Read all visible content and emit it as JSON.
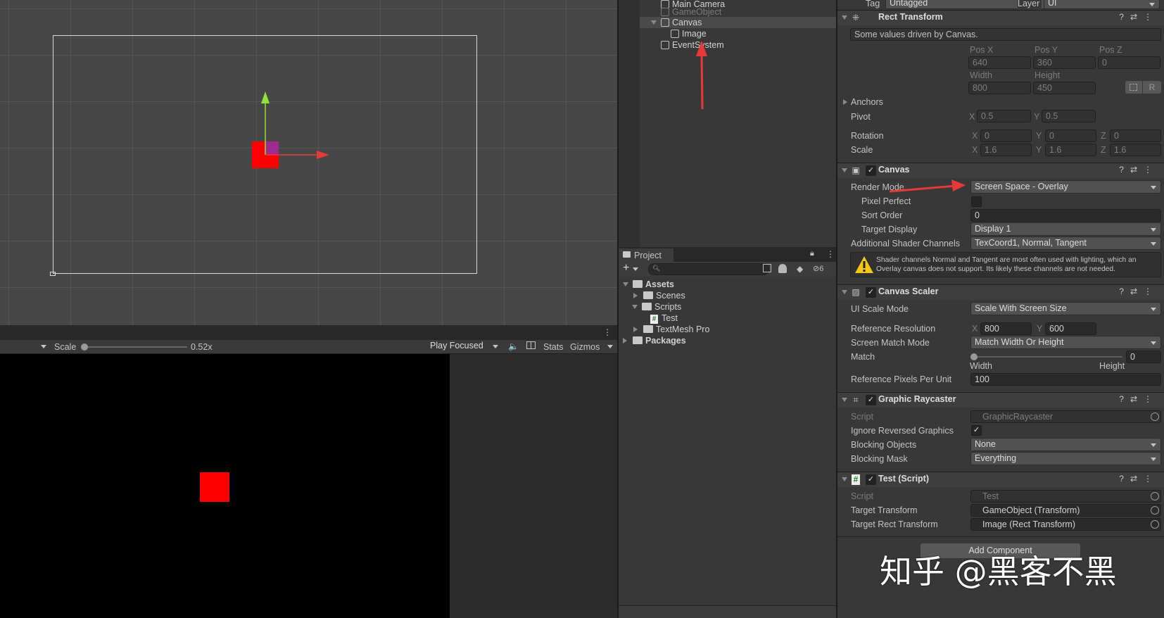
{
  "scene_view": {
    "name": "scene-view"
  },
  "game_toolbar": {
    "scale_label": "Scale",
    "scale_value": "0.52x",
    "scale_fraction": 0.0,
    "play_mode": "Play Focused",
    "stats": "Stats",
    "gizmos": "Gizmos"
  },
  "hierarchy": {
    "items": [
      "Main Camera",
      "GameObject",
      "Canvas",
      "Image",
      "EventSystem"
    ]
  },
  "project": {
    "tab": "Project",
    "badge": "6",
    "tree": [
      "Assets",
      "Scenes",
      "Scripts",
      "Test",
      "TextMesh Pro",
      "Packages"
    ]
  },
  "inspector": {
    "tag_label": "Tag",
    "tag_value": "Untagged",
    "layer_label": "Layer",
    "layer_value": "UI",
    "rect": {
      "title": "Rect Transform",
      "note": "Some values driven by Canvas.",
      "posx_label": "Pos X",
      "posy_label": "Pos Y",
      "posz_label": "Pos Z",
      "posx": "640",
      "posy": "360",
      "posz": "0",
      "width_label": "Width",
      "height_label": "Height",
      "width": "800",
      "height": "450",
      "r_button": "R",
      "anchors": "Anchors",
      "pivot": "Pivot",
      "pivot_x": "0.5",
      "pivot_y": "0.5",
      "rotation": "Rotation",
      "rot_x": "0",
      "rot_y": "0",
      "rot_z": "0",
      "scale": "Scale",
      "scale_x": "1.6",
      "scale_y": "1.6",
      "scale_z": "1.6",
      "x": "X",
      "y": "Y",
      "z": "Z"
    },
    "canvas": {
      "title": "Canvas",
      "render_mode_label": "Render Mode",
      "render_mode": "Screen Space - Overlay",
      "pixel_perfect": "Pixel Perfect",
      "sort_order_label": "Sort Order",
      "sort_order": "0",
      "target_display_label": "Target Display",
      "target_display": "Display 1",
      "shader_label": "Additional Shader Channels",
      "shader_value": "TexCoord1, Normal, Tangent",
      "warning": "Shader channels Normal and Tangent are most often used with lighting, which an Overlay canvas does not support. Its likely these channels are not needed."
    },
    "scaler": {
      "title": "Canvas Scaler",
      "ui_scale_label": "UI Scale Mode",
      "ui_scale": "Scale With Screen Size",
      "ref_res_label": "Reference Resolution",
      "ref_x": "800",
      "ref_y": "600",
      "match_mode_label": "Screen Match Mode",
      "match_mode": "Match Width Or Height",
      "match_label": "Match",
      "match_value": "0",
      "match_width": "Width",
      "match_height": "Height",
      "ppu_label": "Reference Pixels Per Unit",
      "ppu": "100"
    },
    "raycaster": {
      "title": "Graphic Raycaster",
      "script_label": "Script",
      "script": "GraphicRaycaster",
      "ignore_label": "Ignore Reversed Graphics",
      "blocking_label": "Blocking Objects",
      "blocking": "None",
      "mask_label": "Blocking Mask",
      "mask": "Everything"
    },
    "test": {
      "title": "Test (Script)",
      "script_label": "Script",
      "script": "Test",
      "target_label": "Target Transform",
      "target": "GameObject (Transform)",
      "rect_label": "Target Rect Transform",
      "rect": "Image (Rect Transform)"
    },
    "add_component": "Add Component"
  },
  "watermark": "知乎 @黑客不黑",
  "colors": {
    "accent_red": "#ff0000",
    "arrow_red": "#e8393a",
    "gizmo_green": "#8fe33a",
    "warning": "#f5c518"
  }
}
